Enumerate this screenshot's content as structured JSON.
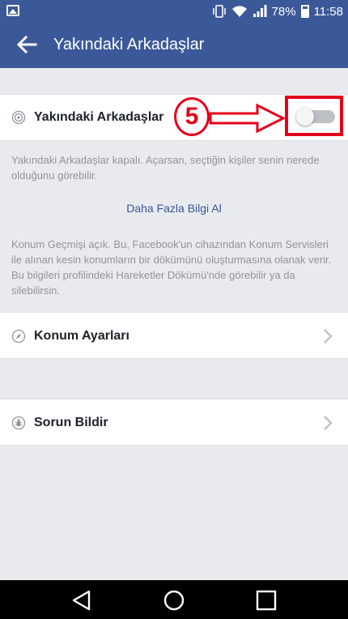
{
  "status_bar": {
    "battery": "78%",
    "time": "11:58",
    "icons": [
      "image-icon",
      "vibrate-icon",
      "wifi-icon",
      "signal-icon",
      "battery-icon"
    ]
  },
  "app_bar": {
    "title": "Yakındaki Arkadaşlar",
    "back_icon": "back-arrow-icon"
  },
  "nearby_friends": {
    "label": "Yakındaki Arkadaşlar",
    "icon": "radar-icon",
    "toggle_on": false
  },
  "description": {
    "off_text": "Yakındaki Arkadaşlar kapalı. Açarsan, seçtiğin kişiler senin nerede olduğunu görebilir.",
    "learn_more": "Daha Fazla Bilgi Al",
    "history_text": "Konum Geçmişi açık. Bu, Facebook'un cihazından Konum Servisleri ile alınan kesin konumların bir dökümünü oluşturmasına olanak verir. Bu bilgileri profilindeki Hareketler Dökümü'nde görebilir ya da silebilirsin."
  },
  "menu": [
    {
      "label": "Konum Ayarları",
      "icon": "compass-icon"
    },
    {
      "label": "Sorun Bildir",
      "icon": "bug-icon"
    }
  ],
  "annotation": {
    "step_number": "5",
    "color": "#e3001b"
  },
  "colors": {
    "brand": "#3b5998",
    "link": "#365899",
    "background": "#e9eaed"
  },
  "nav_bar": {
    "icons": [
      "back-triangle-icon",
      "home-circle-icon",
      "recents-square-icon"
    ]
  }
}
